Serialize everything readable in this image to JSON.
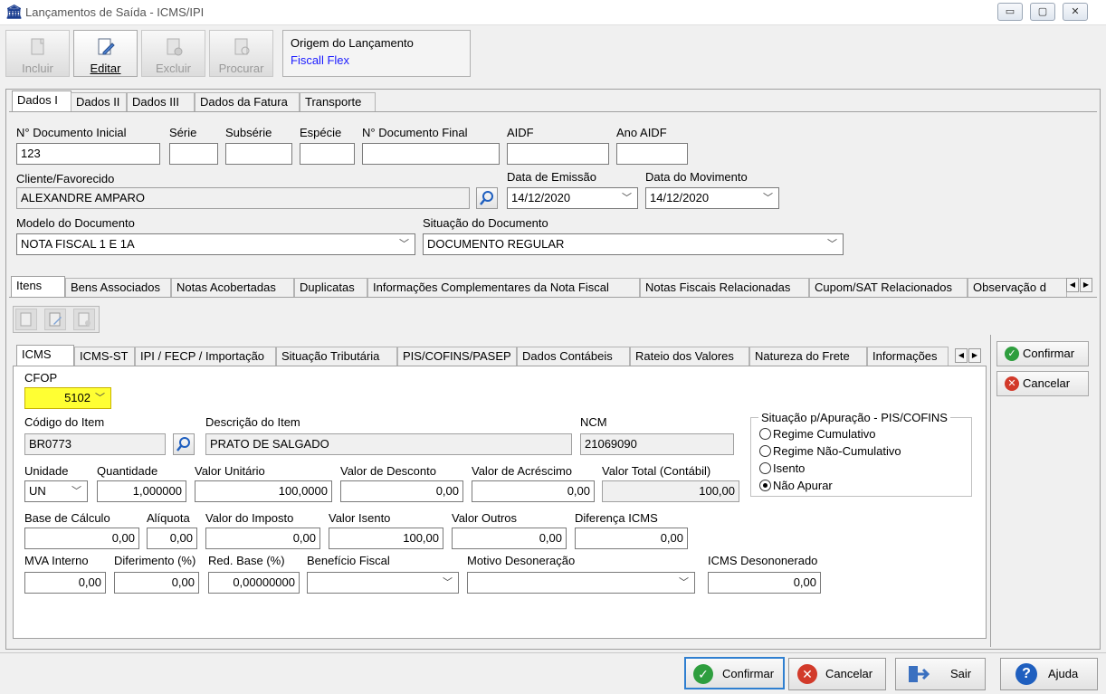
{
  "window": {
    "title": "Lançamentos de Saída - ICMS/IPI",
    "controls": {
      "minimize": "▭",
      "maximize": "▢",
      "close": "✕"
    }
  },
  "toolbar": {
    "buttons": [
      {
        "label": "Incluir",
        "enabled": false
      },
      {
        "label": "Editar",
        "enabled": true
      },
      {
        "label": "Excluir",
        "enabled": false
      },
      {
        "label": "Procurar",
        "enabled": false
      }
    ],
    "origem": {
      "label": "Origem do Lançamento",
      "value": "Fiscall Flex"
    }
  },
  "top_tabs": [
    "Dados I",
    "Dados II",
    "Dados III",
    "Dados da Fatura",
    "Transporte"
  ],
  "dados1": {
    "doc_inicial": {
      "label": "N° Documento Inicial",
      "value": "123"
    },
    "serie": {
      "label": "Série",
      "value": ""
    },
    "subserie": {
      "label": "Subsérie",
      "value": ""
    },
    "especie": {
      "label": "Espécie",
      "value": ""
    },
    "doc_final": {
      "label": "N° Documento Final",
      "value": ""
    },
    "aidf": {
      "label": "AIDF",
      "value": ""
    },
    "ano_aidf": {
      "label": "Ano AIDF",
      "value": ""
    },
    "cliente": {
      "label": "Cliente/Favorecido",
      "value": "ALEXANDRE AMPARO"
    },
    "data_emissao": {
      "label": "Data de Emissão",
      "value": "14/12/2020"
    },
    "data_movimento": {
      "label": "Data do Movimento",
      "value": "14/12/2020"
    },
    "modelo": {
      "label": "Modelo do Documento",
      "value": "NOTA FISCAL 1 E 1A"
    },
    "situacao": {
      "label": "Situação do Documento",
      "value": "DOCUMENTO REGULAR"
    }
  },
  "sub_tabs": [
    "Itens",
    "Bens Associados",
    "Notas Acobertadas",
    "Duplicatas",
    "Informações Complementares da Nota Fiscal",
    "Notas Fiscais Relacionadas",
    "Cupom/SAT Relacionados",
    "Observação d"
  ],
  "item_tabs": [
    "ICMS",
    "ICMS-ST",
    "IPI / FECP / Importação",
    "Situação Tributária",
    "PIS/COFINS/PASEP",
    "Dados Contábeis",
    "Rateio dos Valores",
    "Natureza do Frete",
    "Informações"
  ],
  "icms": {
    "cfop": {
      "label": "CFOP",
      "value": "5102"
    },
    "codigo_item": {
      "label": "Código do Item",
      "value": "BR0773"
    },
    "descricao_item": {
      "label": "Descrição do Item",
      "value": "PRATO DE SALGADO"
    },
    "ncm": {
      "label": "NCM",
      "value": "21069090"
    },
    "unidade": {
      "label": "Unidade",
      "value": "UN"
    },
    "quantidade": {
      "label": "Quantidade",
      "value": "1,000000"
    },
    "valor_unitario": {
      "label": "Valor Unitário",
      "value": "100,0000"
    },
    "valor_desconto": {
      "label": "Valor de Desconto",
      "value": "0,00"
    },
    "valor_acrescimo": {
      "label": "Valor de Acréscimo",
      "value": "0,00"
    },
    "valor_total": {
      "label": "Valor Total (Contábil)",
      "value": "100,00"
    },
    "base_calculo": {
      "label": "Base de Cálculo",
      "value": "0,00"
    },
    "aliquota": {
      "label": "Alíquota",
      "value": "0,00"
    },
    "valor_imposto": {
      "label": "Valor do Imposto",
      "value": "0,00"
    },
    "valor_isento": {
      "label": "Valor Isento",
      "value": "100,00"
    },
    "valor_outros": {
      "label": "Valor Outros",
      "value": "0,00"
    },
    "diferenca_icms": {
      "label": "Diferença ICMS",
      "value": "0,00"
    },
    "mva_interno": {
      "label": "MVA Interno",
      "value": "0,00"
    },
    "diferimento": {
      "label": "Diferimento (%)",
      "value": "0,00"
    },
    "red_base": {
      "label": "Red. Base (%)",
      "value": "0,00000000"
    },
    "beneficio_fiscal": {
      "label": "Benefício Fiscal",
      "value": ""
    },
    "motivo_desoneracao": {
      "label": "Motivo Desoneração",
      "value": ""
    },
    "icms_desonerado": {
      "label": "ICMS Desononerado",
      "value": "0,00"
    }
  },
  "apuracao": {
    "title": "Situação p/Apuração - PIS/COFINS",
    "options": [
      "Regime Cumulativo",
      "Regime Não-Cumulativo",
      "Isento",
      "Não Apurar"
    ],
    "selected": "Não Apurar"
  },
  "side_buttons": {
    "confirmar": "Confirmar",
    "cancelar": "Cancelar"
  },
  "bottom_buttons": {
    "confirmar": "Confirmar",
    "cancelar": "Cancelar",
    "sair": "Sair",
    "ajuda": "Ajuda"
  },
  "colors": {
    "highlight": "#ffff33",
    "link_blue": "#1a1aff",
    "confirm_green": "#2e9e3e",
    "cancel_red": "#d23a2a",
    "help_blue": "#1f5fbf"
  }
}
